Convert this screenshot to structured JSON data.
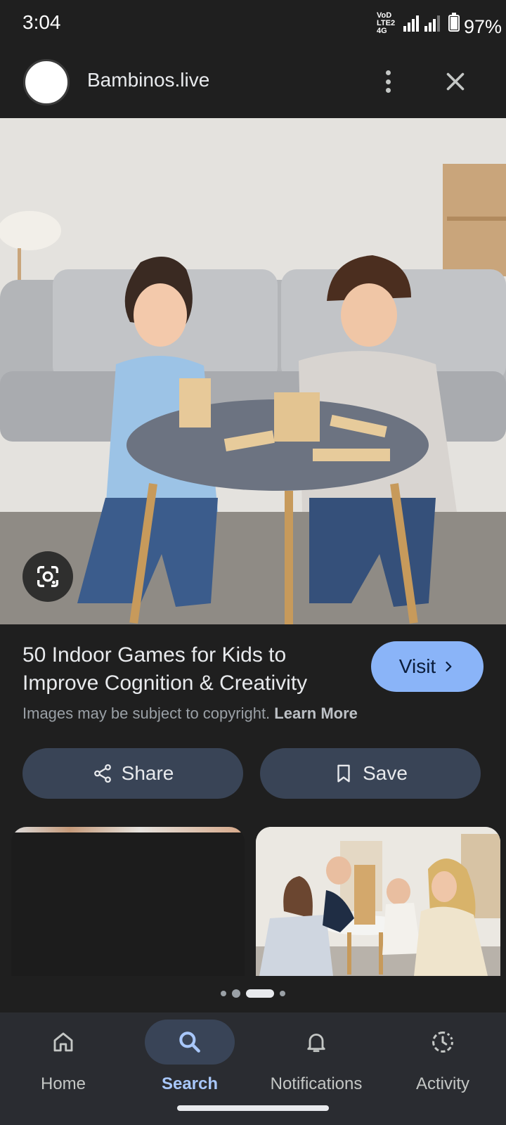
{
  "status_bar": {
    "time": "3:04",
    "network_label": "VoD LTE2 4G",
    "battery": "97%"
  },
  "header": {
    "site_name": "Bambinos.live",
    "more_icon": "more-vert-icon",
    "close_icon": "close-icon"
  },
  "result": {
    "title": "50 Indoor Games for Kids to Improve Cognition & Creativity",
    "visit_label": "Visit",
    "copyright_text": "Images may be subject to copyright.",
    "learn_more_label": "Learn More",
    "share_label": "Share",
    "save_label": "Save"
  },
  "pager": {
    "dot_count": 4,
    "active_index": 2
  },
  "bottom_nav": {
    "items": [
      {
        "label": "Home",
        "icon": "home-icon"
      },
      {
        "label": "Search",
        "icon": "search-icon",
        "active": true
      },
      {
        "label": "Notifications",
        "icon": "bell-icon"
      },
      {
        "label": "Activity",
        "icon": "activity-icon"
      }
    ]
  },
  "colors": {
    "background": "#1f1f1f",
    "accent": "#8ab4f8",
    "button_bg": "#394456",
    "nav_bg": "#2a2c31"
  }
}
